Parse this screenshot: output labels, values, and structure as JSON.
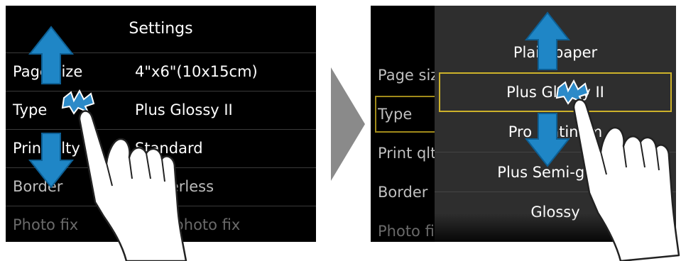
{
  "left_screen": {
    "title": "Settings",
    "rows": [
      {
        "label": "Page size",
        "value": "4\"x6\"(10x15cm)"
      },
      {
        "label": "Type",
        "value": "Plus Glossy II"
      },
      {
        "label": "Print qlty",
        "value": "Standard"
      },
      {
        "label": "Border",
        "value": "Borderless"
      },
      {
        "label": "Photo fix",
        "value": "Auto photo fix"
      }
    ]
  },
  "right_screen": {
    "background_labels": [
      "Page size",
      "Type",
      "Print qlty",
      "Border",
      "Photo fix"
    ],
    "options": [
      "Plain paper",
      "Plus Glossy II",
      "Pro Platinum",
      "Plus Semi-gloss",
      "Glossy"
    ],
    "selected_option": "Plus Glossy II"
  },
  "icons": [
    "scroll-up-arrow-icon",
    "scroll-down-arrow-icon",
    "swipe-hand-icon",
    "touch-sparkle-icon",
    "next-step-chevron-icon"
  ],
  "colors": {
    "screen_bg": "#000000",
    "dropdown_bg": "#2e2e2e",
    "highlight_border": "#cdb22a",
    "arrow_blue": "#1f86c6",
    "chevron_gray": "#8a8a8a"
  }
}
